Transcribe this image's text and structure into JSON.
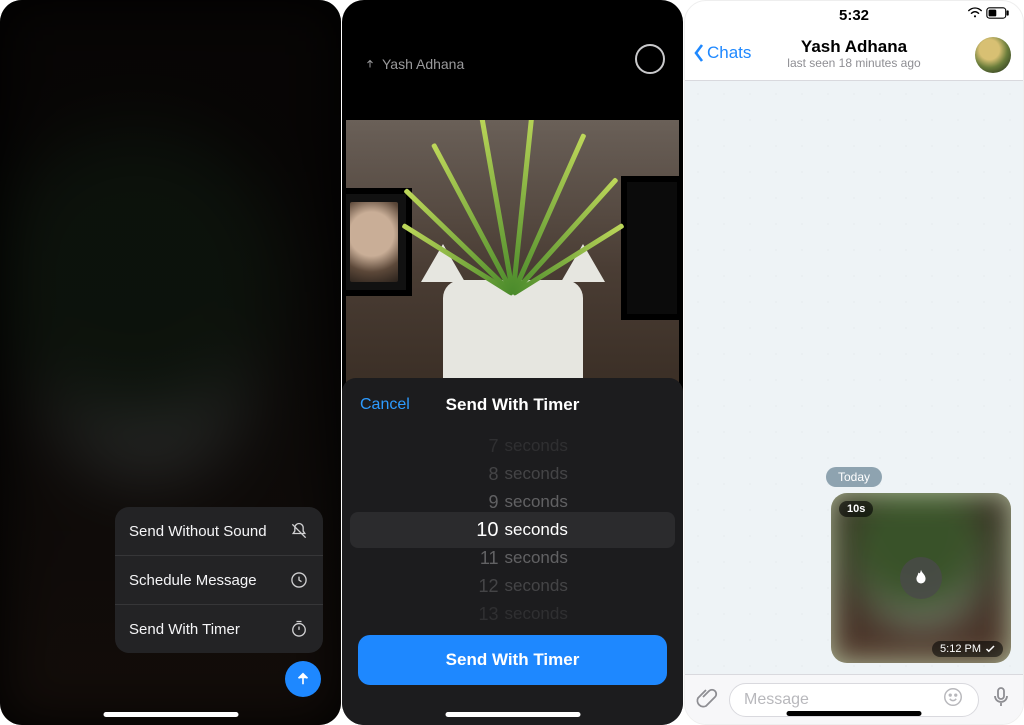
{
  "screen1": {
    "menu": [
      {
        "label": "Send Without Sound",
        "icon": "bell-off-icon"
      },
      {
        "label": "Schedule Message",
        "icon": "clock-icon"
      },
      {
        "label": "Send With Timer",
        "icon": "timer-icon"
      }
    ]
  },
  "screen2": {
    "recipient": "Yash Adhana",
    "sheet_title": "Send With Timer",
    "cancel": "Cancel",
    "button": "Send With Timer",
    "picker_unit": "seconds",
    "picker_values": [
      7,
      8,
      9,
      10,
      11,
      12,
      13
    ],
    "picker_selected": 10
  },
  "screen3": {
    "status_time": "5:32",
    "back_label": "Chats",
    "title": "Yash Adhana",
    "subtitle": "last seen 18 minutes ago",
    "date_pill": "Today",
    "message": {
      "timer_badge": "10s",
      "timestamp": "5:12 PM"
    },
    "input_placeholder": "Message"
  }
}
